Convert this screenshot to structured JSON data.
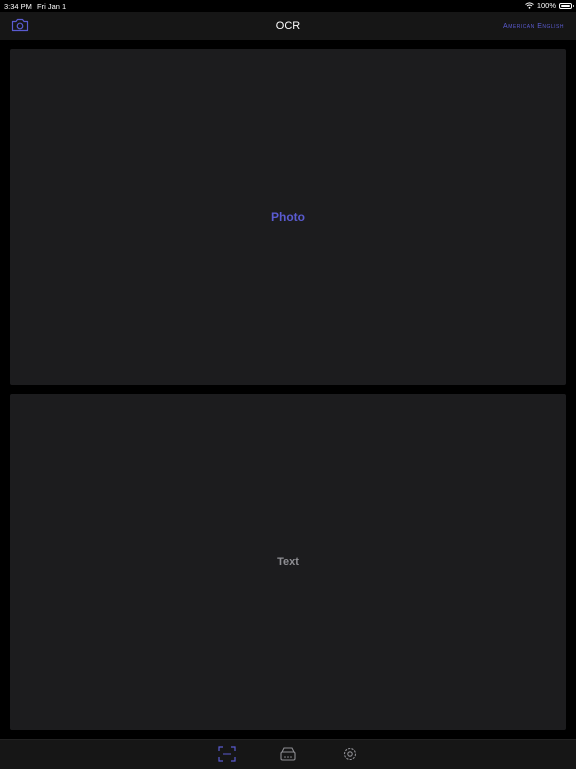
{
  "status_bar": {
    "time": "3:34 PM",
    "date": "Fri Jan 1",
    "battery": "100%"
  },
  "nav": {
    "title": "OCR",
    "language": "American English"
  },
  "photo_panel": {
    "label": "Photo"
  },
  "text_panel": {
    "label": "Text"
  },
  "icons": {
    "camera": "camera-icon",
    "ocr_tab": "ocr-scan-icon",
    "scan_tab": "scanner-icon",
    "settings_tab": "gear-icon"
  },
  "colors": {
    "accent": "#5a5bd0",
    "panel": "#1c1c1e",
    "bar": "#161616"
  }
}
